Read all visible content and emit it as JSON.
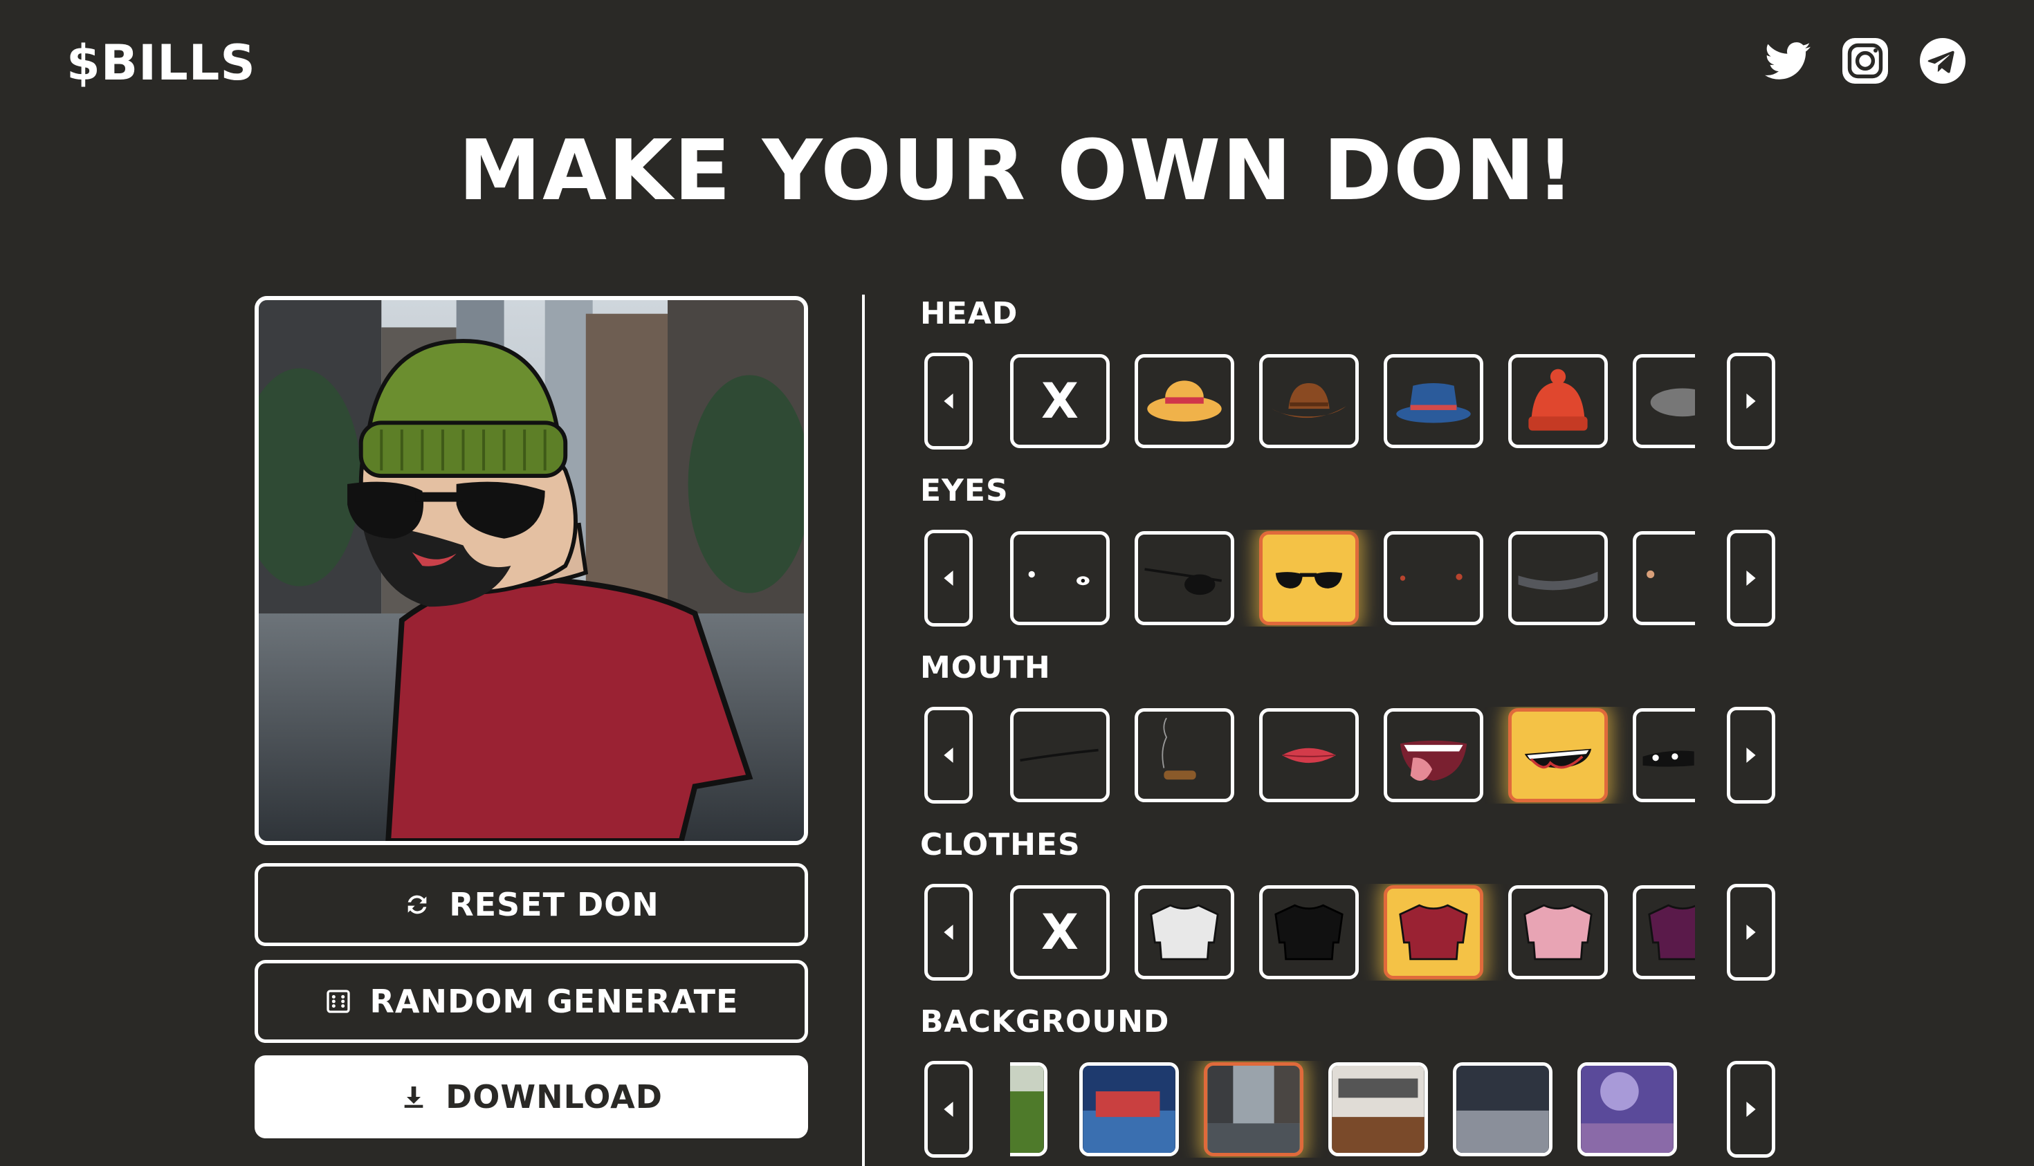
{
  "header": {
    "logo": "$BILLS",
    "socials": [
      {
        "name": "twitter-icon"
      },
      {
        "name": "instagram-icon"
      },
      {
        "name": "telegram-icon"
      }
    ]
  },
  "title": "MAKE YOUR OWN DON!",
  "buttons": {
    "reset": "RESET DON",
    "random": "RANDOM GENERATE",
    "download": "DOWNLOAD"
  },
  "sections": [
    {
      "label": "HEAD",
      "selected_index": null
    },
    {
      "label": "EYES",
      "selected_index": 2
    },
    {
      "label": "MOUTH",
      "selected_index": 4
    },
    {
      "label": "CLOTHES",
      "selected_index": 3
    },
    {
      "label": "BACKGROUND",
      "selected_index": 2
    }
  ],
  "options": {
    "none": "X"
  },
  "colors": {
    "background": "#2a2926",
    "selected_fill": "#f4c246",
    "selected_border": "#e06a3b",
    "shirt": "#9a2233",
    "beanie": "#6b8e2f"
  }
}
